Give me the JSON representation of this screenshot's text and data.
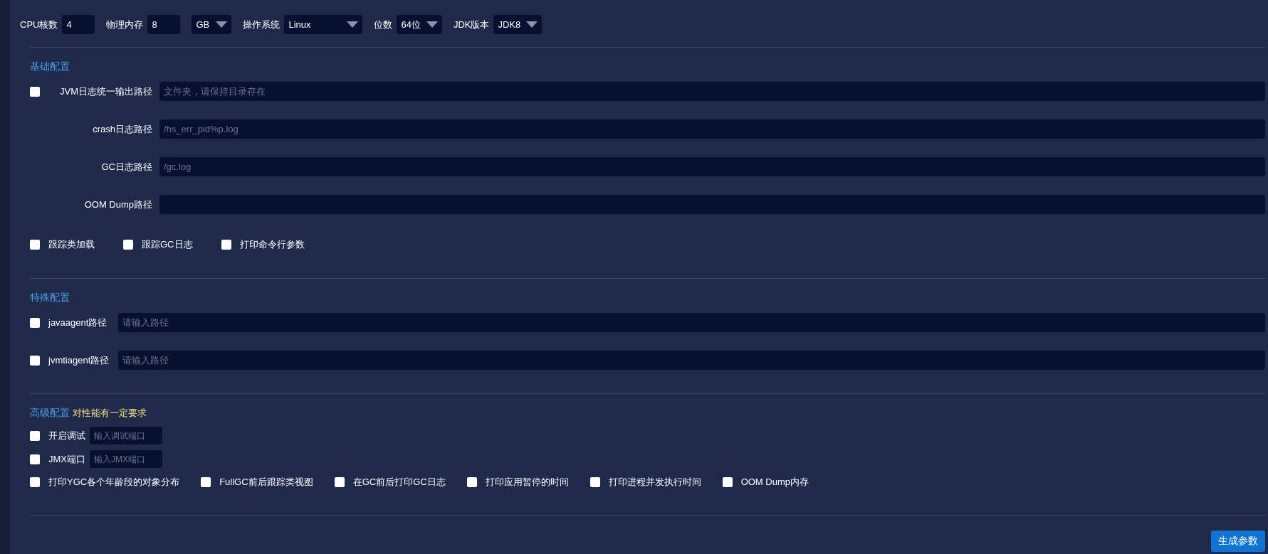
{
  "system": [
    {
      "kind": "input",
      "label": "CPU核数",
      "value": "4"
    },
    {
      "kind": "input",
      "label": "物理内存",
      "value": "8"
    },
    {
      "kind": "select",
      "value": "GB"
    },
    {
      "kind": "wideselect",
      "label": "操作系统",
      "value": "Linux"
    },
    {
      "kind": "select",
      "label": "位数",
      "value": "64位"
    },
    {
      "kind": "select",
      "label": "JDK版本",
      "value": "JDK8"
    }
  ],
  "basic": {
    "title": "基础配置",
    "paths": [
      {
        "label": "JVM日志统一输出路径",
        "checked": false,
        "placeholder": "文件夹，请保持目录存在"
      },
      {
        "label": "crash日志路径",
        "placeholder": "/hs_err_pid%p.log"
      },
      {
        "label": "GC日志路径",
        "placeholder": "/gc.log"
      },
      {
        "label": "OOM Dump路径"
      }
    ],
    "options": [
      {
        "label": "跟踪类加载",
        "checked": false
      },
      {
        "label": "跟踪GC日志",
        "checked": false
      },
      {
        "label": "打印命令行参数",
        "checked": false
      }
    ]
  },
  "special": {
    "title": "特殊配置",
    "paths": [
      {
        "label": "javaagent路径",
        "checked": false,
        "placeholder": "请输入路径"
      },
      {
        "label": "jvmtiagent路径",
        "checked": false,
        "placeholder": "请输入路径"
      }
    ]
  },
  "advanced": {
    "title": "高级配置",
    "note": "对性能有一定要求",
    "ports": [
      {
        "label": "开启调试",
        "checked": false,
        "placeholder": "输入调试端口"
      },
      {
        "label": "JMX端口",
        "checked": false,
        "placeholder": "输入JMX端口"
      }
    ],
    "options": [
      {
        "label": "打印YGC各个年龄段的对象分布",
        "checked": false
      },
      {
        "label": "FullGC前后跟踪类视图",
        "checked": false
      },
      {
        "label": "在GC前后打印GC日志",
        "checked": false
      },
      {
        "label": "打印应用暂停的时间",
        "checked": false
      },
      {
        "label": "打印进程并发执行时间",
        "checked": false
      },
      {
        "label": "OOM Dump内存",
        "checked": false
      }
    ]
  },
  "generate_button": "生成参数"
}
